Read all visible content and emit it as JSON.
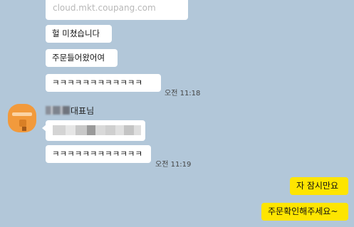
{
  "link_preview": {
    "url": "cloud.mkt.coupang.com"
  },
  "messages": {
    "m1": "헐 미쳤습니다",
    "m2": "주문들어왔어여",
    "m3": "ㅋㅋㅋㅋㅋㅋㅋㅋㅋㅋㅋㅋ",
    "m3_time": "오전 11:18",
    "sender_suffix": "대표님",
    "m4": "ㅋㅋㅋㅋㅋㅋㅋㅋㅋㅋㅋㅋ",
    "m4_time": "오전 11:19",
    "my1": "자 잠시만요",
    "my2": "주문확인해주세요~"
  },
  "colors": {
    "background": "#b2c7d9",
    "my_bubble": "#fee500",
    "their_bubble": "#ffffff"
  }
}
